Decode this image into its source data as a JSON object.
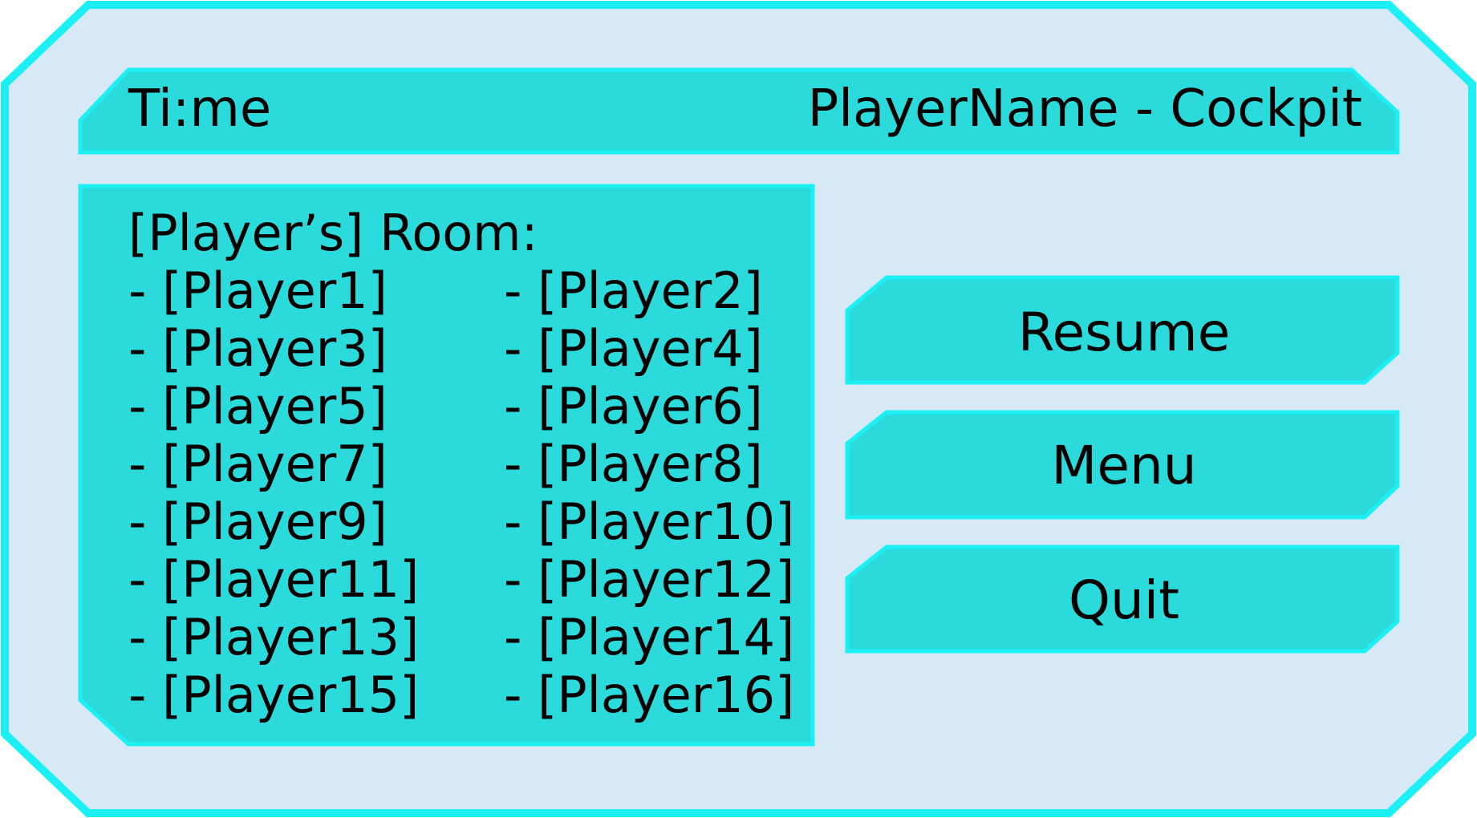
{
  "header": {
    "time_label": "Ti:me",
    "title": "PlayerName - Cockpit"
  },
  "room": {
    "title": "[Player’s] Room:",
    "players": [
      "- [Player1]",
      "- [Player2]",
      "- [Player3]",
      "- [Player4]",
      "- [Player5]",
      "- [Player6]",
      "- [Player7]",
      "- [Player8]",
      "- [Player9]",
      "- [Player10]",
      "- [Player11]",
      "- [Player12]",
      "- [Player13]",
      "- [Player14]",
      "- [Player15]",
      "- [Player16]"
    ]
  },
  "buttons": {
    "resume": "Resume",
    "menu": "Menu",
    "quit": "Quit"
  },
  "colors": {
    "frame_border": "#1CF0F5",
    "frame_fill": "#D7E8F6",
    "panel_fill": "#2BDADB",
    "panel_border": "#1CF0F5"
  }
}
